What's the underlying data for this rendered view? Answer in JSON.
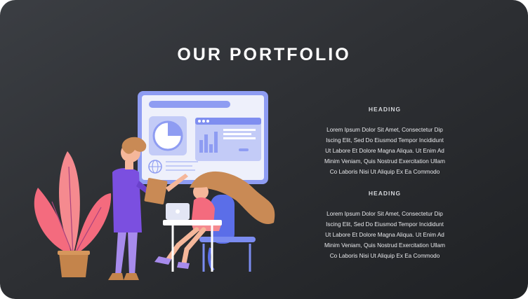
{
  "page": {
    "title": "OUR PORTFOLIO"
  },
  "sections": [
    {
      "heading": "HEADING",
      "lines": [
        "Lorem Ipsum Dolor Sit Amet, Consectetur Dip",
        "Iscing Elit, Sed Do Eiusmod Tempor Incididunt",
        "Ut Labore Et Dolore Magna Aliqua. Ut Enim Ad",
        "Minim Veniam, Quis Nostrud Exercitation Ullam",
        "Co Laboris Nisi Ut Aliquip Ex Ea Commodo"
      ]
    },
    {
      "heading": "HEADING",
      "lines": [
        "Lorem Ipsum Dolor Sit Amet, Consectetur Dip",
        "Iscing Elit, Sed Do Eiusmod Tempor Incididunt",
        "Ut Labore Et Dolore Magna Aliqua. Ut Enim Ad",
        "Minim Veniam, Quis Nostrud Exercitation Ullam",
        "Co Laboris Nisi Ut Aliquip Ex Ea Commodo"
      ]
    }
  ],
  "illustration": {
    "icon": "team-presentation-illustration",
    "colors": {
      "monitor_frame": "#8e9cf2",
      "monitor_screen": "#eef0fb",
      "plant_leaves": "#f46b7e",
      "pot": "#c4844b",
      "hair": "#c98a55",
      "shirt": "#7b4fe0",
      "pants": "#a78bec",
      "chair": "#5b6ee8"
    }
  }
}
